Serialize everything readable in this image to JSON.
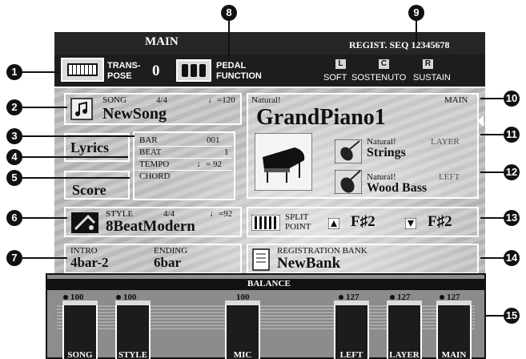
{
  "header": {
    "title": "MAIN",
    "regist": "REGIST. SEQ 12345678"
  },
  "transpose": {
    "label_line1": "TRANS-",
    "label_line2": "POSE",
    "value": "0"
  },
  "pedal": {
    "label_line1": "PEDAL",
    "label_line2": "FUNCTION",
    "items": [
      {
        "key": "L",
        "label": "SOFT"
      },
      {
        "key": "C",
        "label": "SOSTENUTO"
      },
      {
        "key": "R",
        "label": "SUSTAIN"
      }
    ]
  },
  "song": {
    "label": "SONG",
    "time": "4/4",
    "tempo": "♩=120",
    "name": "NewSong"
  },
  "lyrics_button": "Lyrics",
  "score_button": "Score",
  "info": {
    "bar_label": "BAR",
    "bar": "001",
    "beat_label": "BEAT",
    "beat": "1",
    "tempo_label": "TEMPO",
    "tempo": "♩= 92",
    "chord_label": "CHORD"
  },
  "style": {
    "label": "STYLE",
    "time": "4/4",
    "tempo": "♩=92",
    "name": "8BeatModern"
  },
  "intro": {
    "label": "INTRO",
    "value": "4bar-2"
  },
  "ending": {
    "label": "ENDING",
    "value": "6bar"
  },
  "voices": {
    "main": {
      "category": "Natural!",
      "part": "MAIN",
      "name": "GrandPiano1"
    },
    "layer": {
      "category": "Natural!",
      "part": "LAYER",
      "name": "Strings"
    },
    "left": {
      "category": "Natural!",
      "part": "LEFT",
      "name": "Wood Bass"
    }
  },
  "split": {
    "label_line1": "SPLIT",
    "label_line2": "POINT",
    "upper": "F♯2",
    "lower": "F♯2"
  },
  "registration": {
    "label": "REGISTRATION BANK",
    "name": "NewBank"
  },
  "balance": {
    "title": "BALANCE",
    "channels": [
      {
        "label": "SONG",
        "value": "100",
        "dot": true
      },
      {
        "label": "STYLE",
        "value": "100",
        "dot": true
      },
      {
        "label": "MIC",
        "value": "100",
        "dot": false
      },
      {
        "label": "LEFT",
        "value": "127",
        "dot": true
      },
      {
        "label": "LAYER",
        "value": "127",
        "dot": true
      },
      {
        "label": "MAIN",
        "value": "127",
        "dot": true
      }
    ]
  },
  "callouts": [
    "1",
    "2",
    "3",
    "4",
    "5",
    "6",
    "7",
    "8",
    "9",
    "10",
    "11",
    "12",
    "13",
    "14",
    "15"
  ]
}
